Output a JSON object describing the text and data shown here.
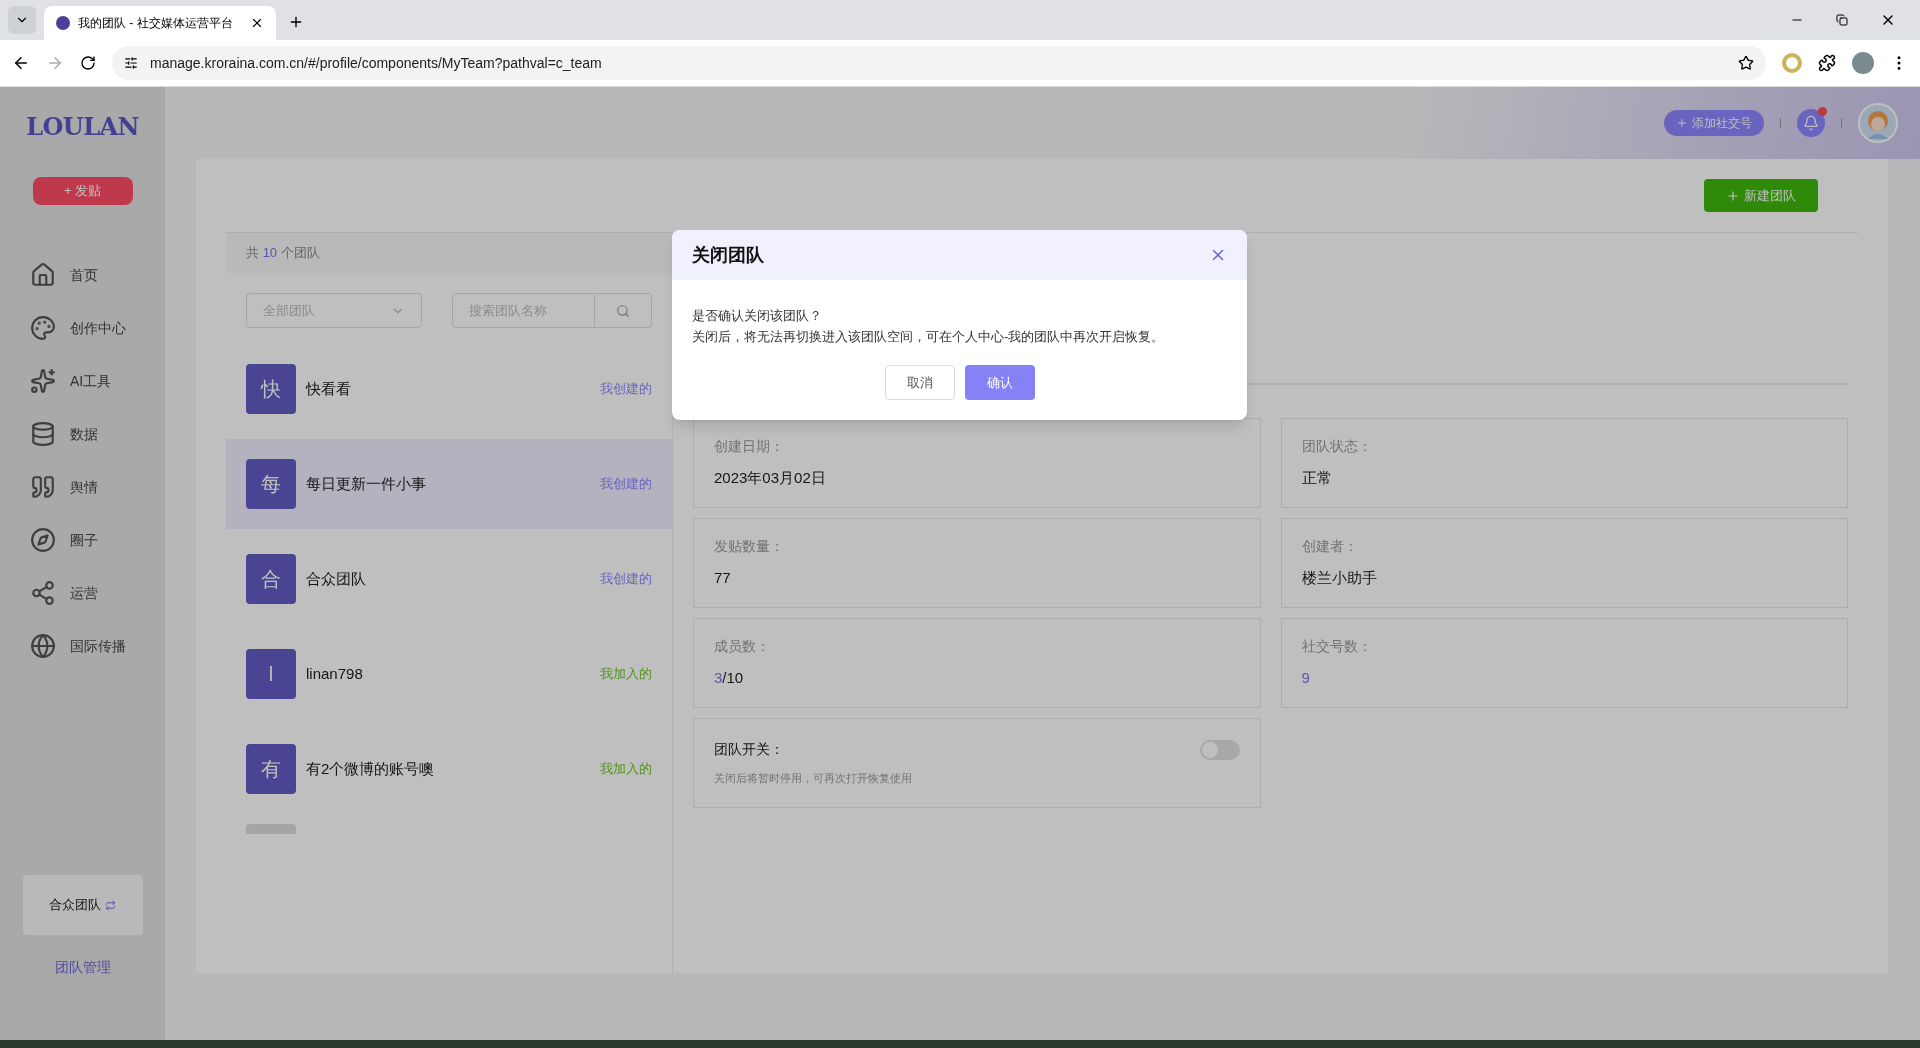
{
  "browser": {
    "tabs": [
      {
        "title": "我的团队 - 社交媒体运营平台",
        "selected": true
      }
    ],
    "url": "manage.kroraina.com.cn/#/profile/components/MyTeam?pathval=c_team"
  },
  "sidebar": {
    "logo": "LOULAN",
    "post_button": "+ 发贴",
    "nav": [
      {
        "label": "首页"
      },
      {
        "label": "创作中心"
      },
      {
        "label": "AI工具"
      },
      {
        "label": "数据"
      },
      {
        "label": "舆情"
      },
      {
        "label": "圈子"
      },
      {
        "label": "运营"
      },
      {
        "label": "国际传播"
      }
    ],
    "team_switcher": "合众团队",
    "manage_link": "团队管理"
  },
  "header": {
    "add_social_button": "添加社交号",
    "has_notification": true
  },
  "main": {
    "new_team_button": "新建团队",
    "count": {
      "prefix": "共",
      "number": "10",
      "suffix": "个团队"
    },
    "filter": {
      "placeholder": "全部团队"
    },
    "search": {
      "placeholder": "搜索团队名称"
    },
    "teams": [
      {
        "initial": "快",
        "name": "快看看",
        "tag": "我创建的",
        "kind": "created",
        "selected": false
      },
      {
        "initial": "每",
        "name": "每日更新一件小事",
        "tag": "我创建的",
        "kind": "created",
        "selected": true
      },
      {
        "initial": "合",
        "name": "合众团队",
        "tag": "我创建的",
        "kind": "created",
        "selected": false
      },
      {
        "initial": "l",
        "name": "linan798",
        "tag": "我加入的",
        "kind": "joined",
        "selected": false
      },
      {
        "initial": "有",
        "name": "有2个微博的账号噢",
        "tag": "我加入的",
        "kind": "joined",
        "selected": false
      }
    ],
    "details": [
      {
        "label": "创建日期：",
        "value": "2023年03月02日"
      },
      {
        "label": "团队状态：",
        "value": "正常"
      },
      {
        "label": "发贴数量：",
        "value": "77"
      },
      {
        "label": "创建者：",
        "value": "楼兰小助手"
      },
      {
        "label": "成员数：",
        "highlight": "3",
        "value": "/10"
      },
      {
        "label": "社交号数：",
        "highlight": "9"
      }
    ],
    "team_switch": {
      "label": "团队开关：",
      "hint": "关闭后将暂时停用，可再次打开恢复使用",
      "on": false
    }
  },
  "dialog": {
    "title": "关闭团队",
    "lines": [
      "是否确认关闭该团队？",
      "关闭后，将无法再切换进入该团队空间，可在个人中心-我的团队中再次开启恢复。"
    ],
    "cancel": "取消",
    "confirm": "确认"
  }
}
